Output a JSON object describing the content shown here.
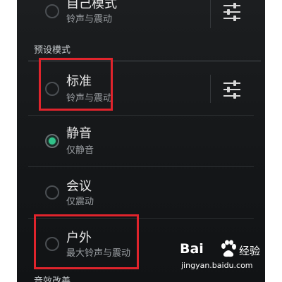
{
  "custom_mode": {
    "title": "自己模式",
    "subtitle": "铃声与震动",
    "selected": false
  },
  "preset_section": {
    "header": "预设模式"
  },
  "profiles": [
    {
      "title": "标准",
      "subtitle": "铃声与震动",
      "selected": false,
      "has_settings": true
    },
    {
      "title": "静音",
      "subtitle": "仅静音",
      "selected": true,
      "has_settings": false
    },
    {
      "title": "会议",
      "subtitle": "仅震动",
      "selected": false,
      "has_settings": false
    },
    {
      "title": "户外",
      "subtitle": "最大铃声与震动",
      "selected": false,
      "has_settings": false
    }
  ],
  "next_section": {
    "header": "音效改善"
  },
  "settings_icon": "equalizer-sliders-icon",
  "colors": {
    "accent_green": "#32c28a",
    "highlight_red": "#e0242c",
    "background": "#1c1e20"
  },
  "watermark": {
    "brand": "Bai",
    "paw_icon": "baidu-paw-icon",
    "suffix": "经验",
    "url": "jingyan.baidu.com"
  }
}
